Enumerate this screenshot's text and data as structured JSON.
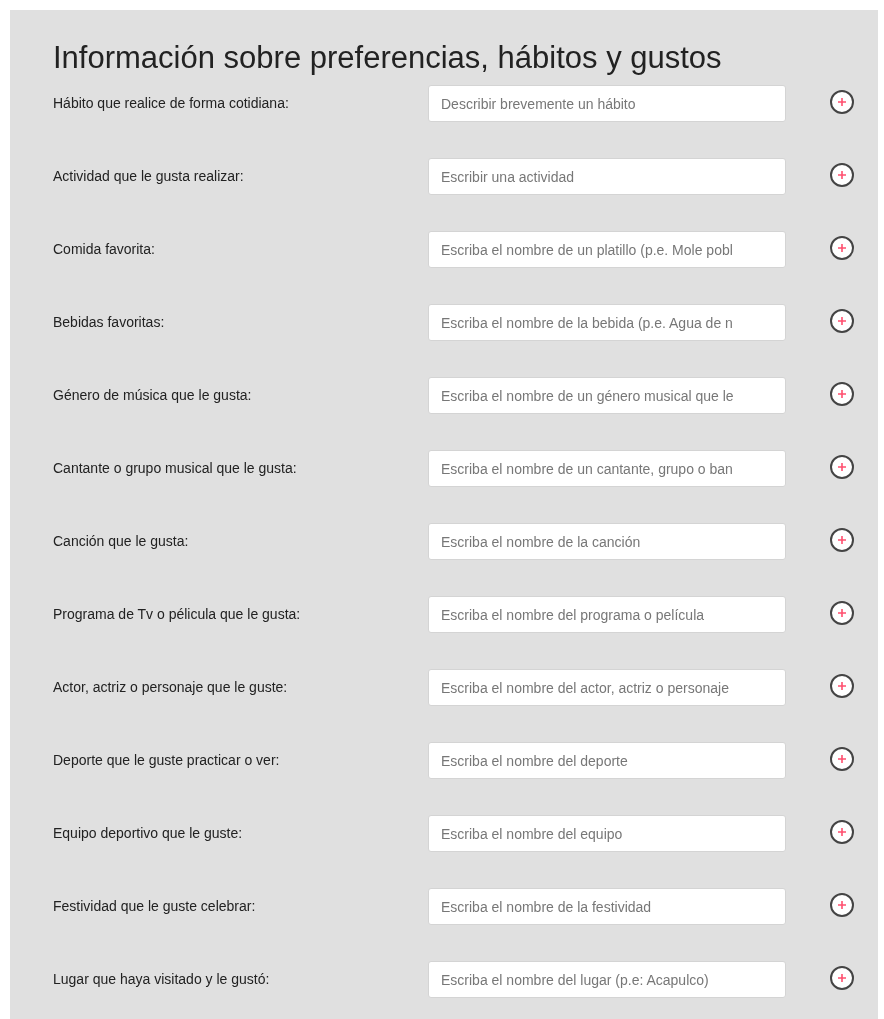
{
  "title": "Información sobre preferencias, hábitos y gustos",
  "fields": [
    {
      "label": "Hábito que realice de forma cotidiana:",
      "placeholder": "Describir brevemente un hábito"
    },
    {
      "label": "Actividad que le gusta realizar:",
      "placeholder": "Escribir una actividad"
    },
    {
      "label": "Comida favorita:",
      "placeholder": "Escriba el nombre de un platillo (p.e. Mole pobl"
    },
    {
      "label": "Bebidas favoritas:",
      "placeholder": "Escriba el nombre de la bebida (p.e. Agua de n"
    },
    {
      "label": "Género de música que le gusta:",
      "placeholder": "Escriba el nombre de un género musical que le"
    },
    {
      "label": "Cantante o grupo musical que le gusta:",
      "placeholder": "Escriba el nombre de un cantante, grupo o ban"
    },
    {
      "label": "Canción que le gusta:",
      "placeholder": "Escriba el nombre de la canción"
    },
    {
      "label": "Programa de Tv o pélicula que le gusta:",
      "placeholder": "Escriba el nombre del programa o película"
    },
    {
      "label": "Actor, actriz o personaje que le guste:",
      "placeholder": "Escriba el nombre del actor, actriz o personaje"
    },
    {
      "label": "Deporte que le guste practicar o ver:",
      "placeholder": "Escriba el nombre del deporte"
    },
    {
      "label": "Equipo deportivo que le guste:",
      "placeholder": "Escriba el nombre del equipo"
    },
    {
      "label": "Festividad que le guste celebrar:",
      "placeholder": "Escriba el nombre de la festividad"
    },
    {
      "label": "Lugar que haya visitado y le gustó:",
      "placeholder": "Escriba el nombre del lugar (p.e: Acapulco)"
    }
  ]
}
